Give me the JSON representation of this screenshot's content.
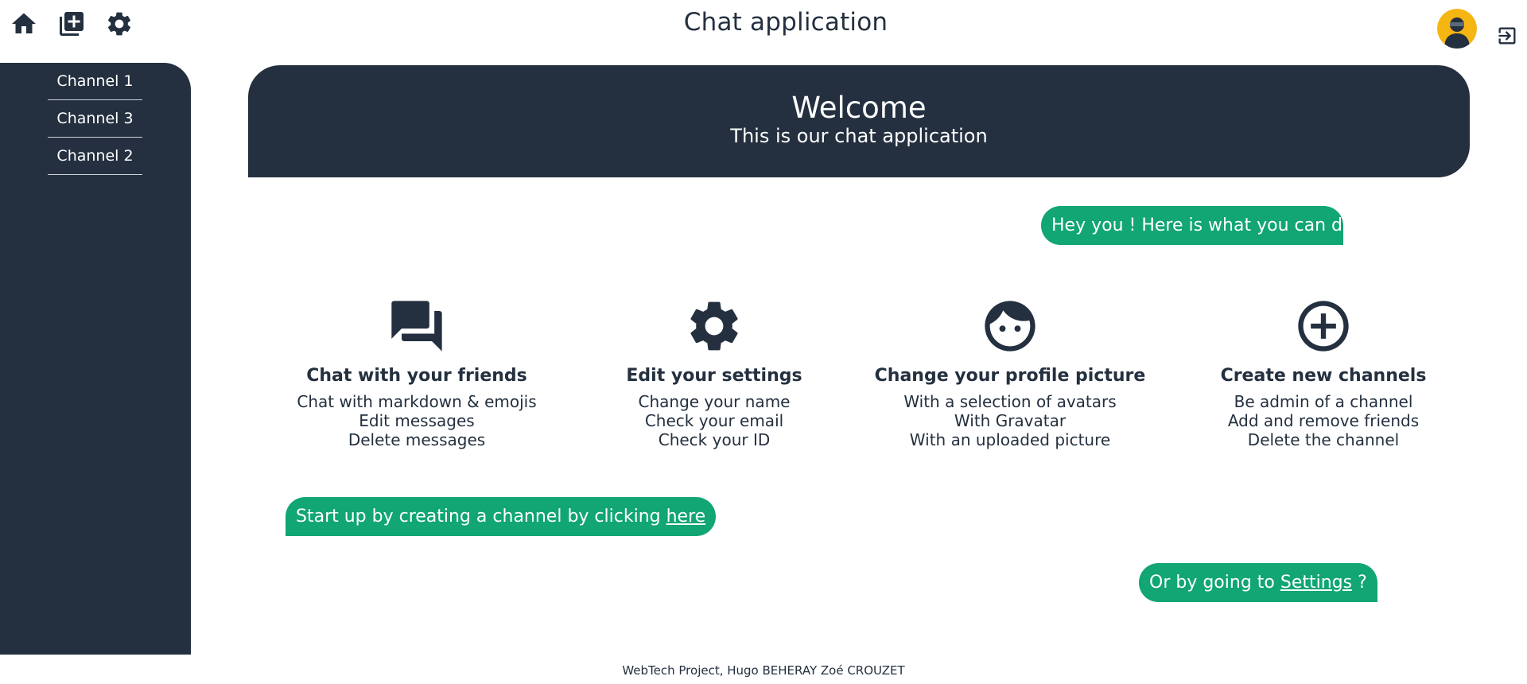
{
  "header": {
    "title": "Chat application",
    "icons": [
      "home-icon",
      "add-box-icon",
      "settings-gear-icon"
    ],
    "logout_icon": "logout-icon"
  },
  "sidebar": {
    "channels": [
      {
        "label": "Channel 1"
      },
      {
        "label": "Channel 3"
      },
      {
        "label": "Channel 2"
      }
    ]
  },
  "welcome": {
    "title": "Welcome",
    "subtitle": "This is our chat application"
  },
  "messages": {
    "intro": "Hey you ! Here is what you can do :",
    "create_prefix": "Start up by creating a channel by clicking ",
    "create_link": "here",
    "settings_prefix": "Or by going to ",
    "settings_link": "Settings",
    "settings_suffix": " ?"
  },
  "features": [
    {
      "icon": "forum-icon",
      "title": "Chat with your friends",
      "lines": [
        "Chat with markdown & emojis",
        "Edit messages",
        "Delete messages"
      ]
    },
    {
      "icon": "settings-gear-icon",
      "title": "Edit your settings",
      "lines": [
        "Change your name",
        "Check your email",
        "Check your ID"
      ]
    },
    {
      "icon": "face-icon",
      "title": "Change your profile picture",
      "lines": [
        "With a selection of avatars",
        "With Gravatar",
        "With an uploaded picture"
      ]
    },
    {
      "icon": "add-circle-icon",
      "title": "Create new channels",
      "lines": [
        "Be admin of a channel",
        "Add and remove friends",
        "Delete the channel"
      ]
    }
  ],
  "footer": {
    "text": "WebTech Project, Hugo BEHERAY Zoé CROUZET"
  },
  "colors": {
    "primary_dark": "#24303f",
    "bubble_green": "#11a673",
    "avatar_yellow": "#f5b512"
  }
}
